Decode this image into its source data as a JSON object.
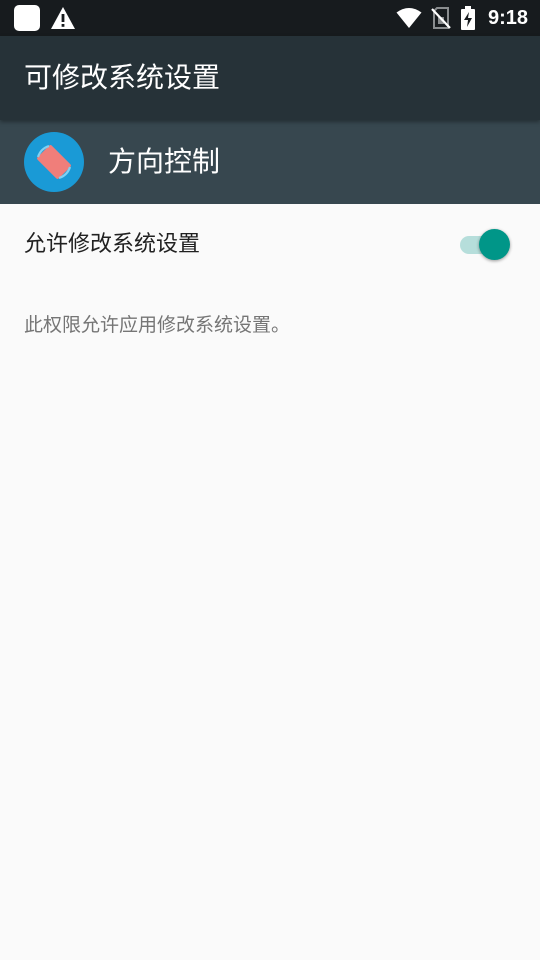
{
  "status_bar": {
    "time": "9:18",
    "icons": [
      "app-notification-icon",
      "warning-icon",
      "wifi-icon",
      "no-sim-icon",
      "battery-charging-icon"
    ]
  },
  "toolbar": {
    "title": "可修改系统设置"
  },
  "app": {
    "name": "方向控制",
    "icon": "screen-rotation-icon"
  },
  "setting": {
    "label": "允许修改系统设置",
    "enabled": true
  },
  "description": "此权限允许应用修改系统设置。",
  "colors": {
    "status_bar": "#171b1e",
    "toolbar": "#263238",
    "app_header": "#37474f",
    "background": "#fafafa",
    "accent": "#009688",
    "app_icon_bg": "#1a9ad6",
    "app_icon_fg": "#f07e7a"
  }
}
